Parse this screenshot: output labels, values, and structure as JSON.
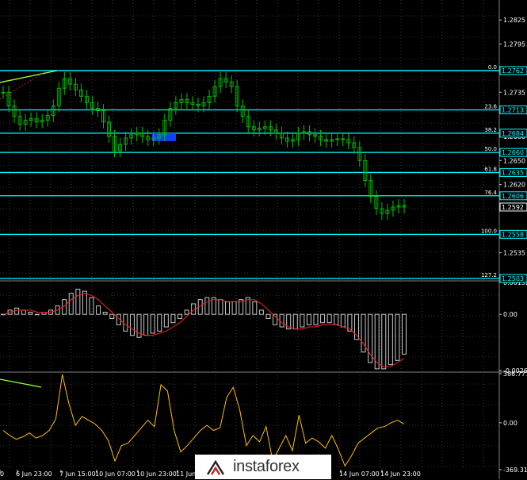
{
  "watermark": {
    "text": "instaforex"
  },
  "colors": {
    "background": "#000000",
    "price": "#00c000",
    "level": "#00ffff",
    "grid": "#606060",
    "histogram": "#c8c8c8",
    "signal": "#ff2020",
    "oscillator": "#ffc000",
    "trendline": "#a0ff40",
    "buyzone": "#1040ff"
  },
  "chart_data": [
    {
      "type": "line",
      "title": "",
      "x_ticks": [
        "0",
        "6 Jun 23:00",
        "7 Jun 15:00",
        "10 Jun 07:00",
        "10 Jun 23:00",
        "11 Jun",
        "14 Jun 07:00",
        "14 Jun 23:00"
      ],
      "y_ticks": [
        "1.2825",
        "1.2795",
        "1.2735",
        "1.2680",
        "1.2650",
        "1.2620",
        "1.2535",
        "1.2505"
      ],
      "ylim": [
        1.2502,
        1.2842
      ],
      "current_price": "1.2592",
      "levels": [
        {
          "fib": "0.0",
          "price": "1.2762"
        },
        {
          "fib": "23.6",
          "price": "1.2713"
        },
        {
          "fib": "38.2",
          "price": "1.2684"
        },
        {
          "fib": "50.0",
          "price": "1.2660"
        },
        {
          "fib": "61.8",
          "price": "1.2635"
        },
        {
          "fib": "76.4",
          "price": "1.2606"
        },
        {
          "fib": "100.0",
          "price": "1.2558"
        },
        {
          "fib": "127.2",
          "price": "1.2503"
        }
      ],
      "price_series": [
        1.2735,
        1.2718,
        1.2705,
        1.2695,
        1.27,
        1.2702,
        1.2698,
        1.27,
        1.2706,
        1.2718,
        1.274,
        1.2752,
        1.2745,
        1.2738,
        1.273,
        1.2722,
        1.2715,
        1.2712,
        1.2698,
        1.268,
        1.2662,
        1.267,
        1.2678,
        1.2682,
        1.2684,
        1.268,
        1.2676,
        1.2678,
        1.2682,
        1.27,
        1.2715,
        1.2722,
        1.2726,
        1.2722,
        1.272,
        1.2718,
        1.2722,
        1.273,
        1.2742,
        1.2752,
        1.2748,
        1.2742,
        1.2718,
        1.2705,
        1.2692,
        1.2688,
        1.269,
        1.2692,
        1.2688,
        1.2684,
        1.2678,
        1.2674,
        1.2676,
        1.2684,
        1.2686,
        1.2682,
        1.268,
        1.2676,
        1.2674,
        1.2676,
        1.2677,
        1.2676,
        1.2672,
        1.2666,
        1.265,
        1.2625,
        1.2605,
        1.259,
        1.2584,
        1.2588,
        1.2592,
        1.2594,
        1.2592
      ]
    },
    {
      "type": "bar",
      "title": "",
      "y_ticks": [
        "0.00152",
        "0.00",
        "-0.00268"
      ],
      "ylim": [
        -0.00268,
        0.00152
      ],
      "histogram": [
        0.0,
        0.0002,
        0.0003,
        0.0002,
        0.0001,
        0.0,
        0.0001,
        0.0002,
        0.0004,
        0.0007,
        0.001,
        0.0012,
        0.0011,
        0.0008,
        0.0004,
        0.0001,
        -0.0002,
        -0.0005,
        -0.0008,
        -0.001,
        -0.0011,
        -0.001,
        -0.0009,
        -0.0008,
        -0.0006,
        -0.0004,
        -0.0002,
        0.0002,
        0.0005,
        0.0007,
        0.0008,
        0.0008,
        0.0007,
        0.0006,
        0.0006,
        0.0007,
        0.0008,
        0.0006,
        0.0002,
        -0.0002,
        -0.0005,
        -0.0006,
        -0.0007,
        -0.0007,
        -0.0006,
        -0.0005,
        -0.0005,
        -0.0004,
        -0.0004,
        -0.0005,
        -0.0006,
        -0.0008,
        -0.0012,
        -0.0018,
        -0.0023,
        -0.0026,
        -0.0026,
        -0.0024,
        -0.0022,
        -0.0019
      ],
      "signal": [
        0.0,
        0.0001,
        0.0002,
        0.0002,
        0.0002,
        0.0001,
        0.0001,
        0.0001,
        0.0002,
        0.0004,
        0.0007,
        0.0009,
        0.001,
        0.0009,
        0.0007,
        0.0004,
        0.0001,
        -0.0002,
        -0.0005,
        -0.0007,
        -0.0009,
        -0.001,
        -0.001,
        -0.0009,
        -0.0008,
        -0.0006,
        -0.0004,
        -0.0001,
        0.0002,
        0.0004,
        0.0006,
        0.0007,
        0.0007,
        0.0006,
        0.0006,
        0.0006,
        0.0007,
        0.0007,
        0.0005,
        0.0002,
        -0.0001,
        -0.0004,
        -0.0006,
        -0.0007,
        -0.0007,
        -0.0006,
        -0.0006,
        -0.0005,
        -0.0005,
        -0.0005,
        -0.0006,
        -0.0007,
        -0.001,
        -0.0014,
        -0.0019,
        -0.0023,
        -0.0025,
        -0.0025,
        -0.0023,
        -0.0021
      ]
    },
    {
      "type": "line",
      "title": "",
      "y_ticks": [
        "386.777",
        "0.00",
        "-369.317"
      ],
      "ylim": [
        -369.317,
        386.777
      ],
      "series": [
        -60,
        -100,
        -130,
        -110,
        -80,
        -120,
        -100,
        -60,
        30,
        380,
        150,
        -20,
        50,
        20,
        -10,
        -60,
        -140,
        -300,
        -180,
        -160,
        -100,
        -40,
        20,
        -30,
        300,
        250,
        -60,
        -230,
        -180,
        -120,
        -60,
        -20,
        -60,
        -40,
        200,
        280,
        100,
        -180,
        -100,
        -150,
        -30,
        -300,
        -200,
        -100,
        -220,
        60,
        -160,
        -120,
        -150,
        -200,
        -100,
        -210,
        -340,
        -260,
        -160,
        -120,
        -80,
        -40,
        -30,
        0,
        20,
        -10
      ]
    }
  ]
}
